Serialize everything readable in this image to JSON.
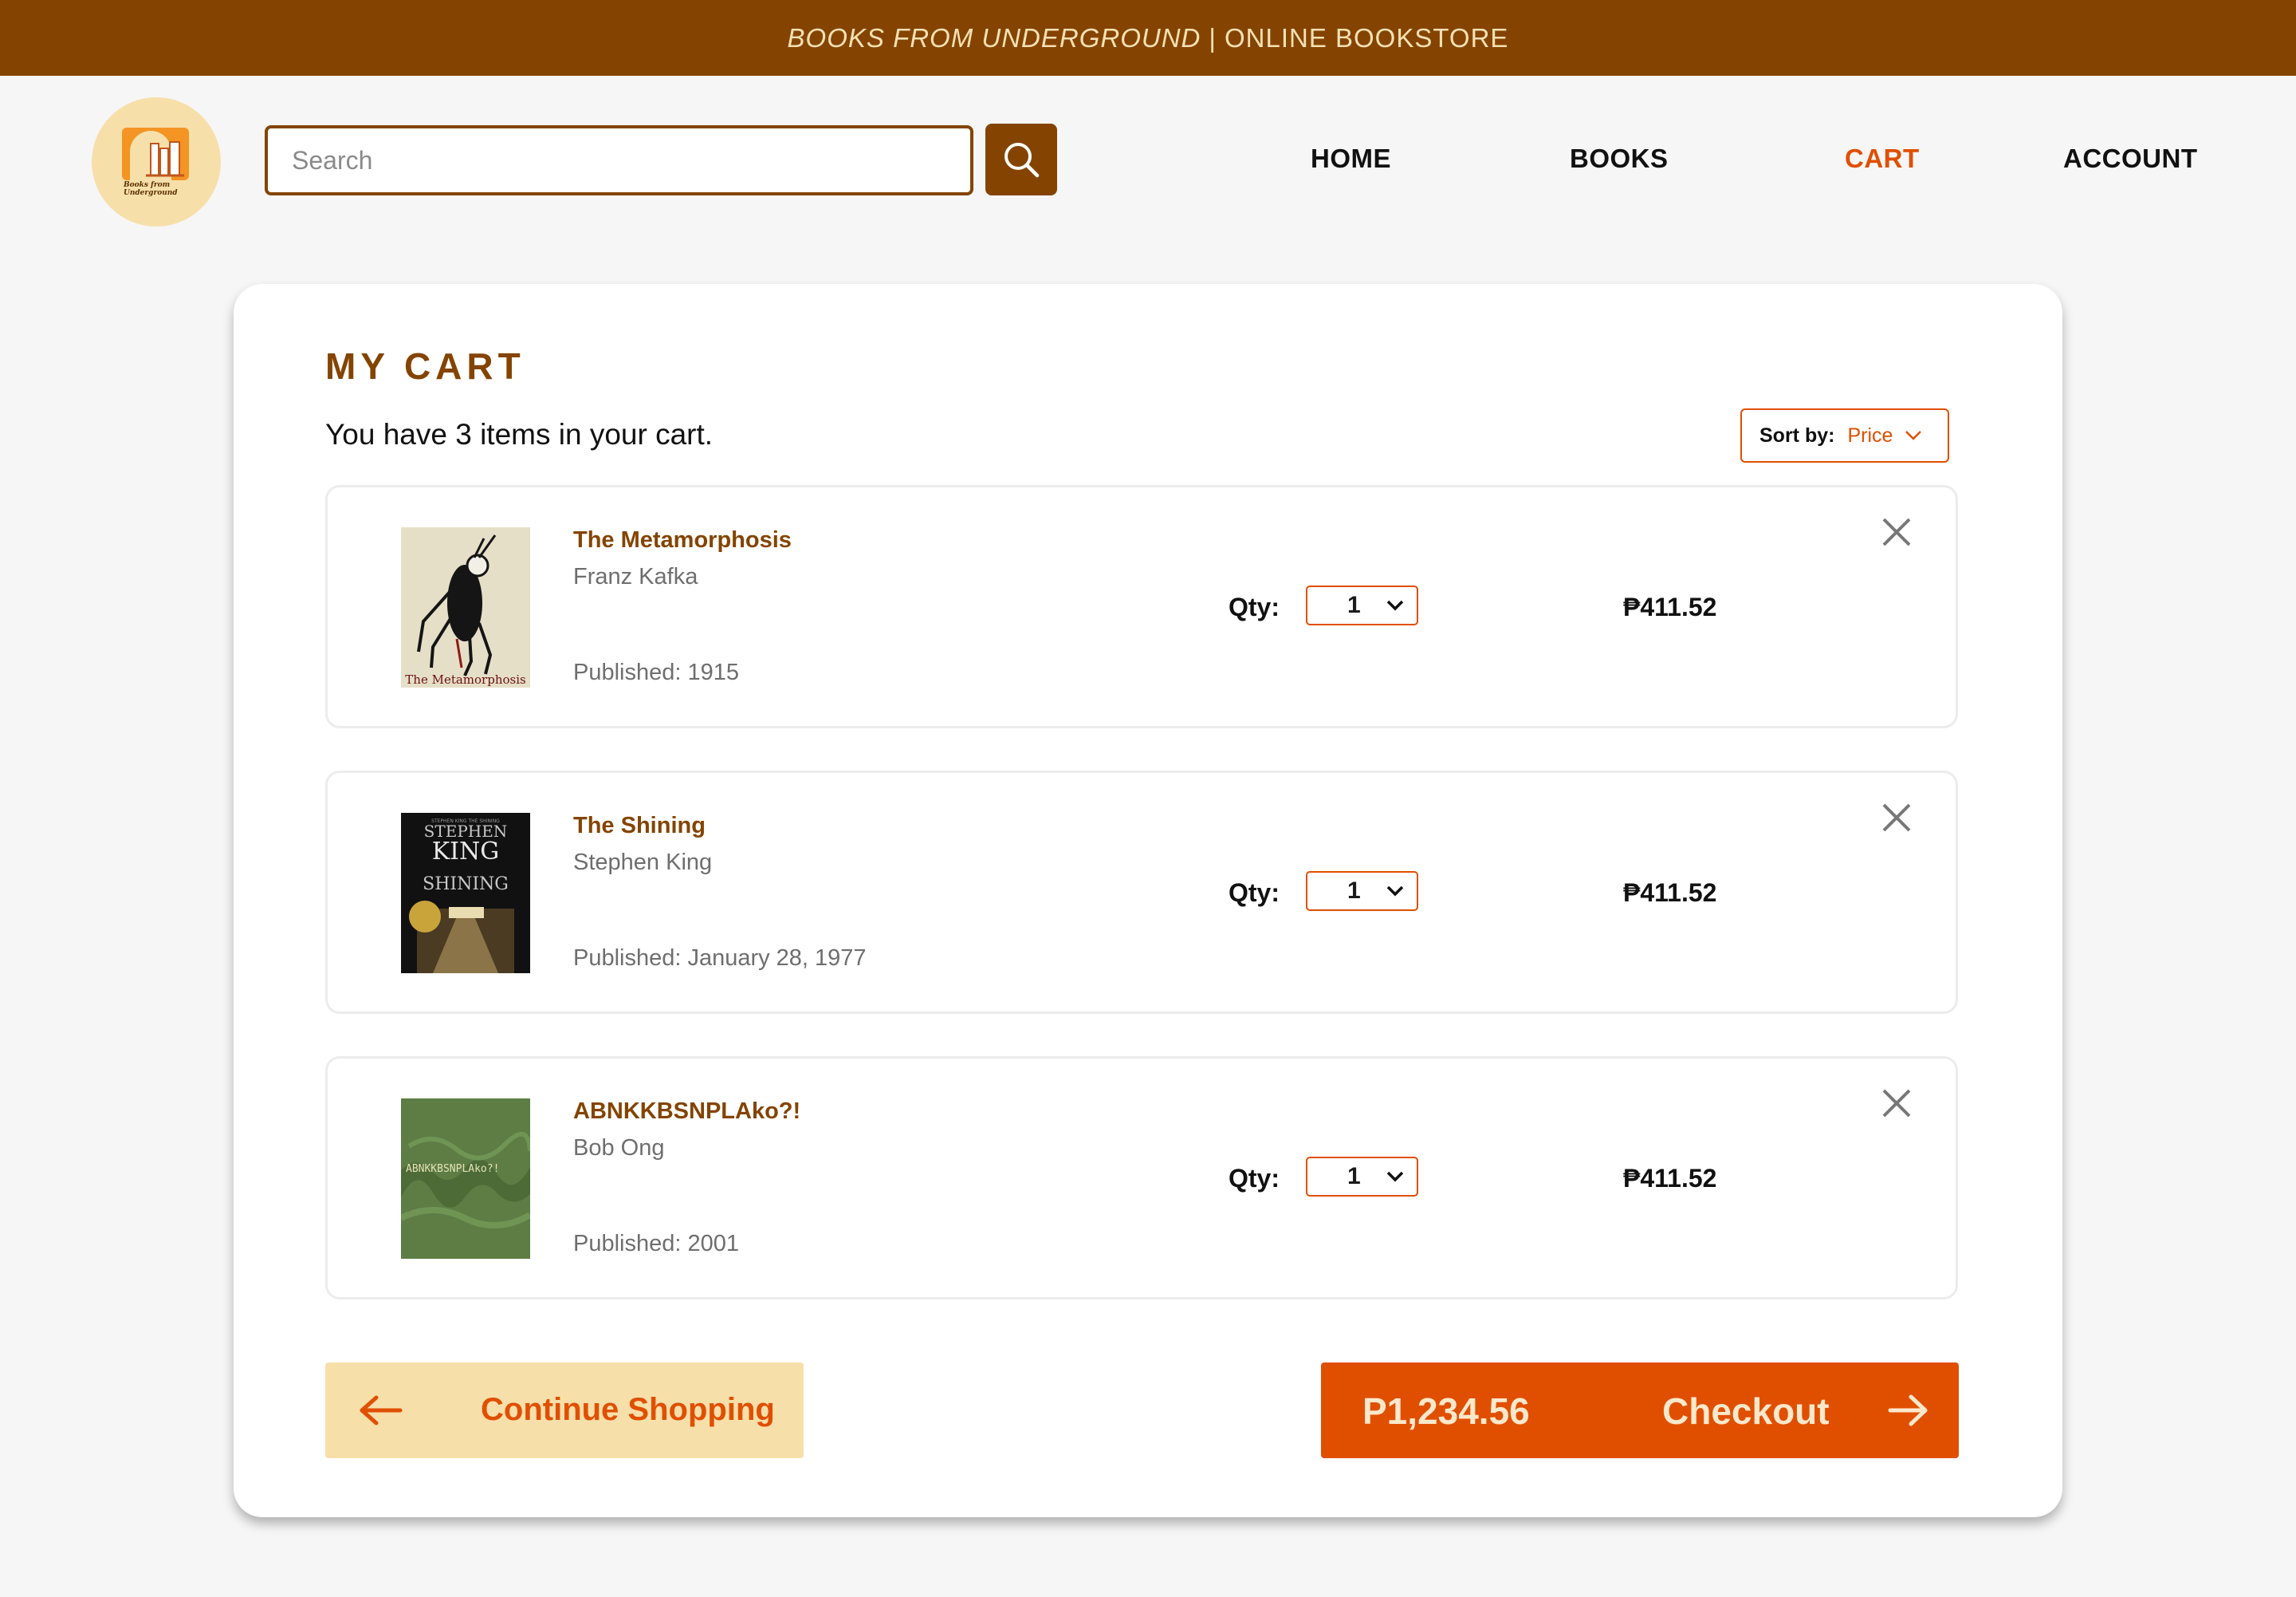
{
  "banner": {
    "brand": "BOOKS FROM UNDERGROUND",
    "separator": "|",
    "tagline": "ONLINE BOOKSTORE"
  },
  "logo": {
    "text": "Books from Underground"
  },
  "search": {
    "placeholder": "Search"
  },
  "nav": {
    "home": "HOME",
    "books": "BOOKS",
    "cart": "CART",
    "account": "ACCOUNT"
  },
  "cart": {
    "title": "MY CART",
    "summary": "You have 3 items in your cart.",
    "sort_label": "Sort by:",
    "sort_value": "Price",
    "qty_label": "Qty:",
    "published_label": "Published:",
    "items": [
      {
        "title": "The Metamorphosis",
        "author": "Franz Kafka",
        "published": "1915",
        "qty": "1",
        "price": "₱411.52",
        "cover_caption": "The Metamorphosis"
      },
      {
        "title": "The Shining",
        "author": "Stephen King",
        "published": "January 28, 1977",
        "qty": "1",
        "price": "₱411.52",
        "cover_caption": "STEPHEN KING THE SHINING"
      },
      {
        "title": "ABNKKBSNPLAko?!",
        "author": "Bob Ong",
        "published": "2001",
        "qty": "1",
        "price": "₱411.52",
        "cover_caption": "ABNKKBSNPLAko?!"
      }
    ]
  },
  "actions": {
    "continue_label": "Continue Shopping",
    "total": "P1,234.56",
    "checkout_label": "Checkout"
  },
  "colors": {
    "brown": "#844400",
    "orange": "#e04f00",
    "cream": "#f7dfaa"
  },
  "icons": {
    "search": "search-icon",
    "remove": "close-icon",
    "dropdown": "chevron-down-icon",
    "back": "arrow-left-icon",
    "forward": "arrow-right-icon"
  }
}
